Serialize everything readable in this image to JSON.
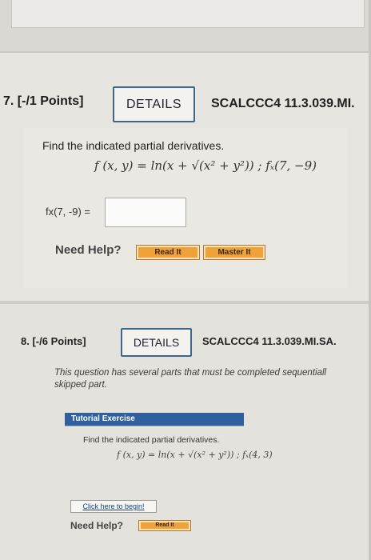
{
  "q7": {
    "number": "7. [-/1 Points]",
    "details_label": "DETAILS",
    "source": "SCALCCC4 11.3.039.MI.",
    "instruction": "Find the indicated partial derivatives.",
    "formula": "f (x, y) = ln(x + √(x² + y²)) ; fₓ(7, −9)",
    "answer_label": "fx(7, -9) =",
    "answer_value": "",
    "need_help": "Need Help?",
    "read_it": "Read It",
    "master_it": "Master It"
  },
  "q8": {
    "number": "8. [-/6 Points]",
    "details_label": "DETAILS",
    "source": "SCALCCC4 11.3.039.MI.SA.",
    "note": "This question has several parts that must be completed sequentiall",
    "note_line2": "skipped part.",
    "tutorial_label": "Tutorial Exercise",
    "instruction": "Find the indicated partial derivatives.",
    "formula": "f (x, y) = ln(x + √(x² + y²)) ; fₓ(4, 3)",
    "begin_link": "Click here to begin!",
    "need_help": "Need Help?",
    "read_it": "Read It"
  },
  "colors": {
    "details_border": "#3d6688",
    "button_orange": "#f0a13a",
    "tutorial_bar": "#2f5f9e",
    "link": "#1d3f88"
  }
}
